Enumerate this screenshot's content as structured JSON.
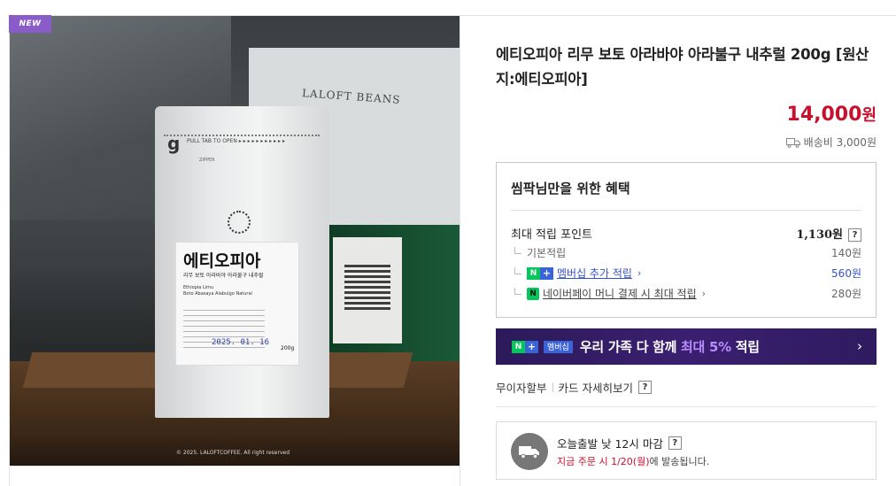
{
  "image": {
    "badge": "NEW",
    "bag_logo": "g",
    "bag_pull_text": "PULL TAB TO OPEN ▸ ▸ ▸ ▸ ▸ ▸ ▸ ▸ ▸ ▸ ▸",
    "bag_zipper_text": "ZIPPER",
    "label_title": "에티오피아",
    "label_subtitle": "리무 보토 아라바야 아라불구 내추럴",
    "label_en_1": "Ethiopia Limu",
    "label_en_2": "Boto Abasaya Alabulgo Natural",
    "label_date": "2025. 01. 16",
    "label_weight": "200g",
    "sign_text": "LALOFT BEANS",
    "copyright": "© 2025. LALOFTCOFFEE. All right reserved"
  },
  "product": {
    "title": "에티오피아 리무 보토 아라바야 아라불구 내추럴 200g [원산지:에티오피아]",
    "price": "14,000",
    "price_unit": "원",
    "shipping": "배송비 3,000원"
  },
  "benefits": {
    "title": "씸팍님만을 위한 혜택",
    "max_points_label": "최대 적립 포인트",
    "max_points_value": "1,130원",
    "help": "?",
    "rows": [
      {
        "label": "기본적립",
        "value": "140원"
      },
      {
        "label": "멤버십 추가 적립",
        "value": "560원"
      },
      {
        "label": "네이버페이 머니 결제 시 최대 적립",
        "value": "280원"
      }
    ],
    "np_n": "N",
    "np_plus": "+",
    "npay": "N"
  },
  "banner": {
    "tag": "멤버십",
    "text_1": "우리 가족 다 함께 ",
    "highlight": "최대 5%",
    "text_2": " 적립",
    "chevron": "›"
  },
  "card": {
    "installment": "무이자할부",
    "details": "카드 자세히보기",
    "help": "?"
  },
  "delivery": {
    "line1": "오늘출발 낮 12시 마감",
    "help": "?",
    "line2_red": "지금 주문 시 1/20(월)",
    "line2_rest": "에 발송됩니다."
  }
}
